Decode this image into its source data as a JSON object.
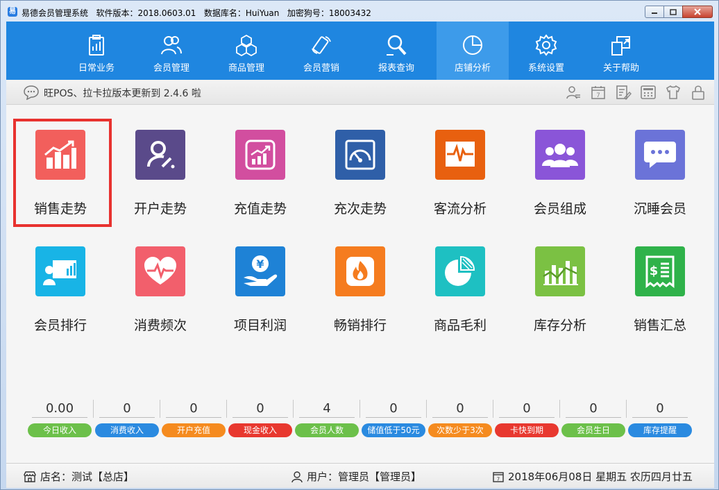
{
  "titlebar": {
    "app_name": "易德会员管理系统",
    "version": "软件版本：2018.0603.01",
    "database": "数据库名：HuiYuan",
    "dongle": "加密狗号：18003432"
  },
  "nav": {
    "items": [
      {
        "label": "日常业务",
        "icon": "clipboard-icon"
      },
      {
        "label": "会员管理",
        "icon": "members-icon"
      },
      {
        "label": "商品管理",
        "icon": "cubes-icon"
      },
      {
        "label": "会员营销",
        "icon": "phone-icon"
      },
      {
        "label": "报表查询",
        "icon": "magnifier-icon"
      },
      {
        "label": "店铺分析",
        "icon": "pie-chart-icon",
        "active": true
      },
      {
        "label": "系统设置",
        "icon": "gear-icon"
      },
      {
        "label": "关于帮助",
        "icon": "help-icon"
      }
    ]
  },
  "notice": {
    "text": "旺POS、拉卡拉版本更新到 2.4.6 啦"
  },
  "tiles": [
    {
      "label": "销售走势",
      "color": "#f25f5c",
      "icon": "sales-trend-icon",
      "selected": true
    },
    {
      "label": "开户走势",
      "color": "#5a4a8a",
      "icon": "account-trend-icon"
    },
    {
      "label": "充值走势",
      "color": "#d24e9f",
      "icon": "recharge-trend-icon"
    },
    {
      "label": "充次走势",
      "color": "#2f5fa8",
      "icon": "gauge-icon"
    },
    {
      "label": "客流分析",
      "color": "#e8600f",
      "icon": "pulse-icon"
    },
    {
      "label": "会员组成",
      "color": "#8a55d8",
      "icon": "group-icon"
    },
    {
      "label": "沉睡会员",
      "color": "#6b73d8",
      "icon": "chat-icon"
    },
    {
      "label": "会员排行",
      "color": "#18b4e6",
      "icon": "presentation-icon"
    },
    {
      "label": "消费频次",
      "color": "#f25f6c",
      "icon": "heart-pulse-icon"
    },
    {
      "label": "项目利润",
      "color": "#1e82d6",
      "icon": "coin-hand-icon"
    },
    {
      "label": "畅销排行",
      "color": "#f57c1f",
      "icon": "flame-icon"
    },
    {
      "label": "商品毛利",
      "color": "#1ec0c2",
      "icon": "pie-icon"
    },
    {
      "label": "库存分析",
      "color": "#7bc143",
      "icon": "stock-chart-icon"
    },
    {
      "label": "销售汇总",
      "color": "#2fb24a",
      "icon": "receipt-icon"
    }
  ],
  "stats": [
    {
      "value": "0.00",
      "label": "今日收入",
      "color": "#6cc04a"
    },
    {
      "value": "0",
      "label": "消费收入",
      "color": "#2a8ae0"
    },
    {
      "value": "0",
      "label": "开户充值",
      "color": "#f58b1f"
    },
    {
      "value": "0",
      "label": "现金收入",
      "color": "#e8382f"
    },
    {
      "value": "4",
      "label": "会员人数",
      "color": "#6cc04a"
    },
    {
      "value": "0",
      "label": "储值低于50元",
      "color": "#2a8ae0"
    },
    {
      "value": "0",
      "label": "次数少于3次",
      "color": "#f58b1f"
    },
    {
      "value": "0",
      "label": "卡快到期",
      "color": "#e8382f"
    },
    {
      "value": "0",
      "label": "会员生日",
      "color": "#6cc04a"
    },
    {
      "value": "0",
      "label": "库存提醒",
      "color": "#2a8ae0"
    }
  ],
  "statusbar": {
    "store": "店名：测试【总店】",
    "user": "用户：管理员【管理员】",
    "date": "2018年06月08日 星期五 农历四月廿五"
  }
}
